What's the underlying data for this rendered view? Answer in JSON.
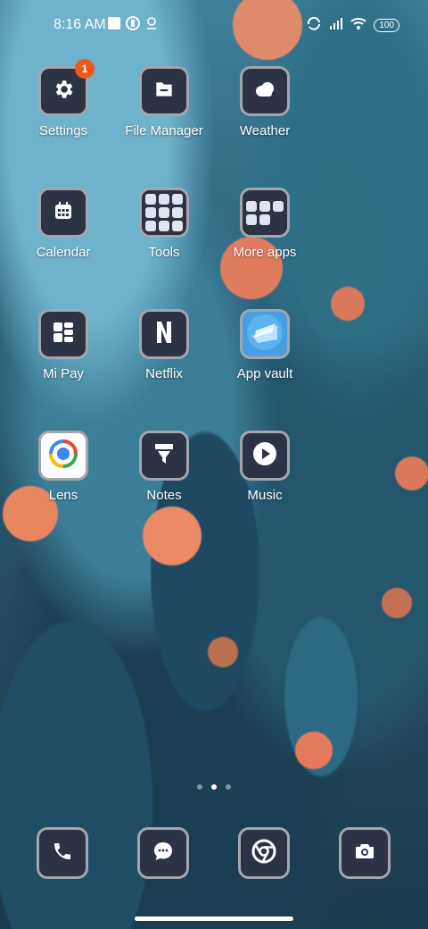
{
  "status_bar": {
    "time": "8:16 AM",
    "battery": "100",
    "left_icons": [
      "square-notification-icon",
      "app-notification-icon",
      "location-icon"
    ],
    "right_icons": [
      "sync-icon",
      "signal-icon",
      "wifi-icon",
      "battery-icon"
    ]
  },
  "apps": [
    {
      "name": "settings",
      "label": "Settings",
      "icon": "gear-icon",
      "badge": "1"
    },
    {
      "name": "file-manager",
      "label": "File Manager",
      "icon": "folder-icon"
    },
    {
      "name": "weather",
      "label": "Weather",
      "icon": "cloud-icon"
    },
    {
      "name": "calendar",
      "label": "Calendar",
      "icon": "calendar-icon"
    },
    {
      "name": "tools-folder",
      "label": "Tools",
      "icon": "folder-grid-icon"
    },
    {
      "name": "more-apps-folder",
      "label": "More apps",
      "icon": "folder-grid-icon"
    },
    {
      "name": "mi-pay",
      "label": "Mi Pay",
      "icon": "mi-pay-icon"
    },
    {
      "name": "netflix",
      "label": "Netflix",
      "icon": "netflix-icon"
    },
    {
      "name": "app-vault",
      "label": "App vault",
      "icon": "app-vault-icon"
    },
    {
      "name": "lens",
      "label": "Lens",
      "icon": "lens-icon"
    },
    {
      "name": "notes",
      "label": "Notes",
      "icon": "notes-icon"
    },
    {
      "name": "music",
      "label": "Music",
      "icon": "play-icon"
    }
  ],
  "page_indicator": {
    "pages": 3,
    "current": 2
  },
  "dock": [
    {
      "name": "phone",
      "icon": "phone-icon"
    },
    {
      "name": "messages",
      "icon": "message-icon"
    },
    {
      "name": "chrome",
      "icon": "chrome-icon"
    },
    {
      "name": "camera",
      "icon": "camera-icon"
    }
  ],
  "colors": {
    "badge": "#ef5a1c",
    "tile_bg": "#2c3344",
    "tile_border": "#a2a6ae"
  }
}
